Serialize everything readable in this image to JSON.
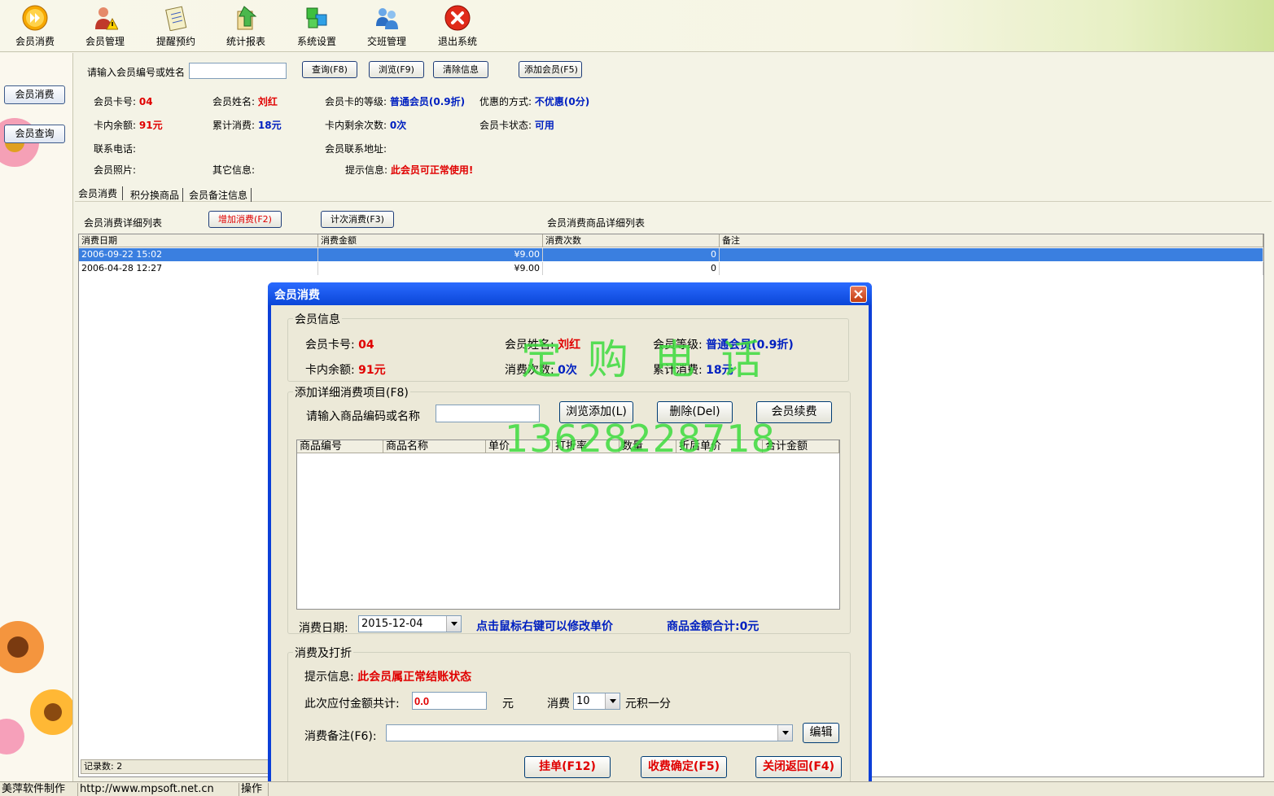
{
  "toolbar": {
    "items": [
      {
        "label": "会员消费",
        "icon": "play-circle-icon"
      },
      {
        "label": "会员管理",
        "icon": "member-warning-icon"
      },
      {
        "label": "提醒预约",
        "icon": "notepad-icon"
      },
      {
        "label": "统计报表",
        "icon": "chart-report-icon"
      },
      {
        "label": "系统设置",
        "icon": "settings-blocks-icon"
      },
      {
        "label": "交班管理",
        "icon": "handover-users-icon"
      },
      {
        "label": "退出系统",
        "icon": "exit-x-icon"
      }
    ]
  },
  "sidebar": {
    "items": [
      {
        "label": "会员消费"
      },
      {
        "label": "会员查询"
      }
    ]
  },
  "search": {
    "label": "请输入会员编号或姓名",
    "value": "",
    "query_btn": "查询(F8)",
    "browse_btn": "浏览(F9)",
    "clear_btn": "清除信息",
    "add_btn": "添加会员(F5)"
  },
  "member": {
    "card_no_label": "会员卡号:",
    "card_no": "04",
    "name_label": "会员姓名:",
    "name": "刘红",
    "level_label": "会员卡的等级:",
    "level": "普通会员(0.9折)",
    "discount_label": "优惠的方式:",
    "discount": "不优惠(0分)",
    "balance_label": "卡内余额:",
    "balance": "91元",
    "total_label": "累计消费:",
    "total": "18元",
    "remain_label": "卡内剩余次数:",
    "remain": "0次",
    "status_label": "会员卡状态:",
    "status": "可用",
    "phone_label": "联系电话:",
    "address_label": "会员联系地址:",
    "photo_label": "会员照片:",
    "other_label": "其它信息:",
    "hint_label": "提示信息:",
    "hint": "此会员可正常使用!"
  },
  "tabs": [
    {
      "label": "会员消费"
    },
    {
      "label": "积分换商品"
    },
    {
      "label": "会员备注信息"
    }
  ],
  "consume": {
    "list_title": "会员消费详细列表",
    "add_btn": "增加消费(F2)",
    "count_btn": "计次消费(F3)",
    "goods_title": "会员消费商品详细列表",
    "columns": [
      "消费日期",
      "消费金额",
      "消费次数",
      "备注"
    ],
    "rows": [
      {
        "date": "2006-09-22 15:02",
        "amount": "¥9.00",
        "count": "0",
        "note": ""
      },
      {
        "date": "2006-04-28 12:27",
        "amount": "¥9.00",
        "count": "0",
        "note": ""
      }
    ],
    "record_count": "记录数: 2"
  },
  "dialog": {
    "title": "会员消费",
    "info_legend": "会员信息",
    "card_no_label": "会员卡号:",
    "card_no": "04",
    "name_label": "会员姓名:",
    "name": "刘红",
    "level_label": "会员等级:",
    "level": "普通会员(0.9折)",
    "balance_label": "卡内余额:",
    "balance": "91元",
    "times_label": "消费次数:",
    "times": "0次",
    "total_label": "累计消费:",
    "total": "18元",
    "add_legend": "添加详细消费项目(F8)",
    "goods_input_label": "请输入商品编码或名称",
    "goods_input_value": "",
    "browse_add_btn": "浏览添加(L)",
    "delete_btn": "删除(Del)",
    "renew_btn": "会员续费",
    "columns": [
      "商品编号",
      "商品名称",
      "单价",
      "打折率",
      "数量",
      "折后单价",
      "合计金额"
    ],
    "date_label": "消费日期:",
    "date_value": "2015-12-04",
    "right_click_hint": "点击鼠标右键可以修改单价",
    "goods_total": "商品金额合计:0元",
    "discount_legend": "消费及打折",
    "hint_label": "提示信息:",
    "hint": "此会员属正常结账状态",
    "payable_label": "此次应付金额共计:",
    "payable_value": "0.0",
    "yuan": "元",
    "points_label": "消费",
    "points_value": "10",
    "points_suffix": "元积一分",
    "note_label": "消费备注(F6):",
    "note_value": "",
    "edit_btn": "编辑",
    "hang_btn": "挂单(F12)",
    "confirm_btn": "收费确定(F5)",
    "close_btn": "关闭返回(F4)"
  },
  "watermark": {
    "line1": "定 购 电 话",
    "line2": "13628228718"
  },
  "statusbar": {
    "maker": "美萍软件制作",
    "url": "http://www.mpsoft.net.cn",
    "op": "操作"
  }
}
